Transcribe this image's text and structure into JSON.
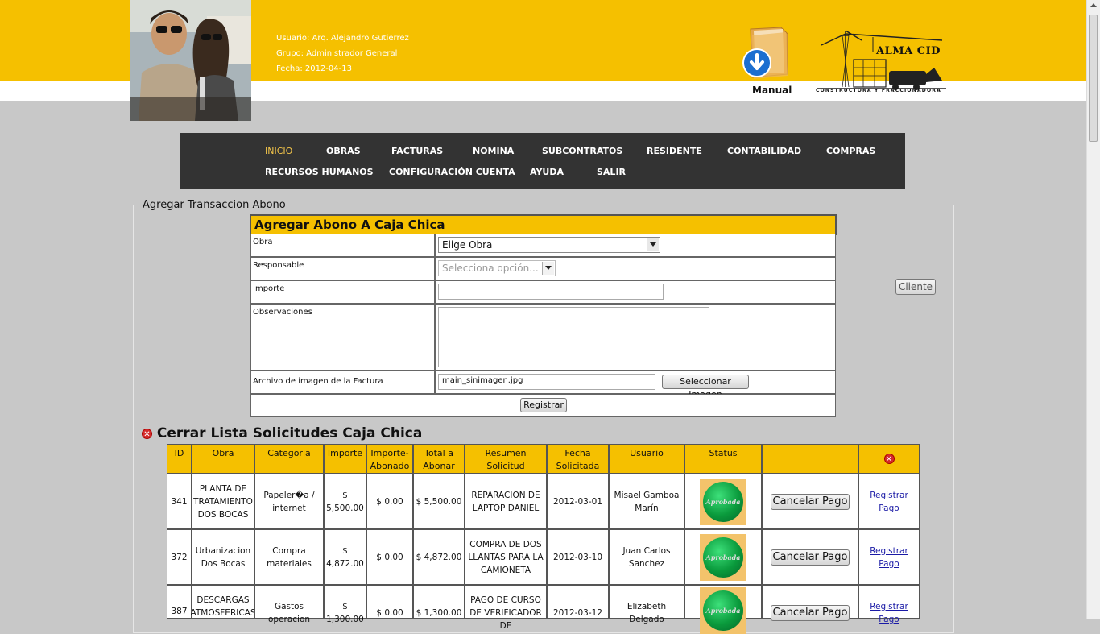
{
  "user": {
    "usuario": "Usuario: Arq. Alejandro Gutierrez",
    "grupo": "Grupo: Administrador General",
    "fecha": "Fecha: 2012-04-13"
  },
  "manual_label": "Manual",
  "logo": {
    "name": "ALMA CID",
    "subtitle": "CONSTRUCTORA Y FRACCIONADORA"
  },
  "nav": {
    "items": [
      "INICIO",
      "OBRAS",
      "FACTURAS",
      "NOMINA",
      "SUBCONTRATOS",
      "RESIDENTE",
      "CONTABILIDAD",
      "COMPRAS",
      "RECURSOS HUMANOS",
      "CONFIGURACIÓN CUENTA",
      "AYUDA",
      "SALIR"
    ],
    "active": "INICIO"
  },
  "fieldset_legend": "Agregar Transaccion Abono",
  "form": {
    "title": "Agregar Abono A Caja Chica",
    "obra_label": "Obra",
    "obra_value": "Elige Obra",
    "responsable_label": "Responsable",
    "responsable_placeholder": "Selecciona opción...",
    "importe_label": "Importe",
    "importe_value": "",
    "observaciones_label": "Observaciones",
    "archivo_label": "Archivo de imagen de la Factura",
    "archivo_value": "main_sinimagen.jpg",
    "seleccionar_label": "Seleccionar Imagen",
    "registrar_label": "Registrar"
  },
  "cliente_label": "Cliente",
  "list_title": "Cerrar Lista Solicitudes Caja Chica",
  "table": {
    "headers": [
      "ID",
      "Obra",
      "Categoria",
      "Importe",
      "Importe-\nAbonado",
      "Total a\nAbonar",
      "Resumen Solicitud",
      "Fecha\nSolicitada",
      "Usuario",
      "Status",
      "",
      ""
    ],
    "rows": [
      {
        "id": "341",
        "obra": "PLANTA DE TRATAMIENTO DOS BOCAS",
        "categoria": "Papeler�a / internet",
        "importe": "$ 5,500.00",
        "abonado": "$ 0.00",
        "total": "$ 5,500.00",
        "resumen": "REPARACION DE LAPTOP DANIEL",
        "fecha": "2012-03-01",
        "usuario": "Misael Gamboa Marín",
        "status": "Aprobada",
        "cancel": "Cancelar Pago",
        "registrar": "Registrar Pago"
      },
      {
        "id": "372",
        "obra": "Urbanizacion Dos Bocas",
        "categoria": "Compra materiales",
        "importe": "$ 4,872.00",
        "abonado": "$ 0.00",
        "total": "$ 4,872.00",
        "resumen": "COMPRA DE DOS LLANTAS PARA LA CAMIONETA",
        "fecha": "2012-03-10",
        "usuario": "Juan Carlos Sanchez",
        "status": "Aprobada",
        "cancel": "Cancelar Pago",
        "registrar": "Registrar Pago"
      },
      {
        "id": "387",
        "obra": "DESCARGAS ATMOSFERICAS",
        "categoria": "Gastos operacion",
        "importe": "$ 1,300.00",
        "abonado": "$ 0.00",
        "total": "$ 1,300.00",
        "resumen": "PAGO DE CURSO DE VERIFICADOR DE",
        "fecha": "2012-03-12",
        "usuario": "Elizabeth Delgado",
        "status": "Aprobada",
        "cancel": "Cancelar Pago",
        "registrar": "Registrar Pago"
      }
    ]
  }
}
